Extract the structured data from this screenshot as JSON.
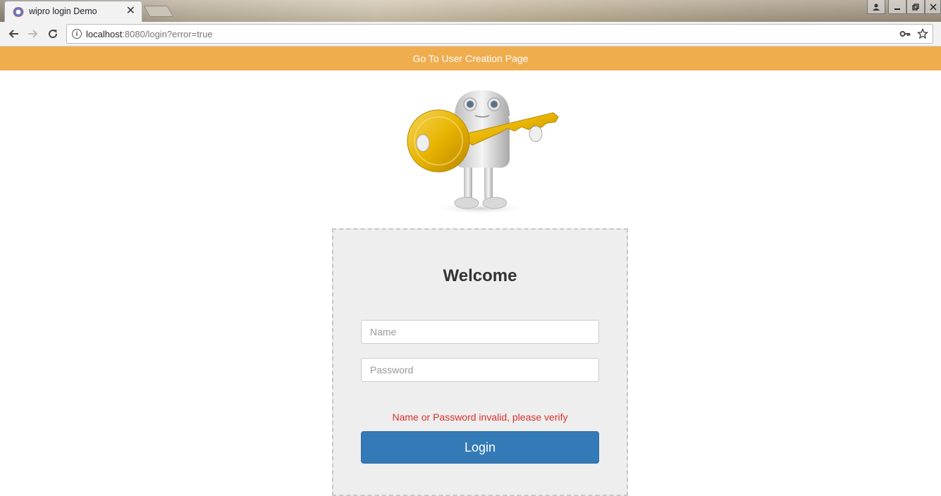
{
  "browser": {
    "tab_title": "wipro login Demo",
    "tab_close": "✕",
    "url_host": "localhost",
    "url_rest": ":8080/login?error=true"
  },
  "icons": {
    "favicon": "wipro-favicon-icon",
    "back": "back-arrow-icon",
    "forward": "forward-arrow-icon",
    "reload": "reload-icon",
    "info": "info-icon",
    "key": "key-icon",
    "star": "star-icon"
  },
  "banner": {
    "link_text": "Go To User Creation Page",
    "color": "#f0ad4e"
  },
  "login": {
    "heading": "Welcome",
    "name_placeholder": "Name",
    "password_placeholder": "Password",
    "error_message": "Name or Password invalid, please verify",
    "submit_label": "Login",
    "button_color": "#337ab7",
    "error_color": "#d9302c"
  }
}
